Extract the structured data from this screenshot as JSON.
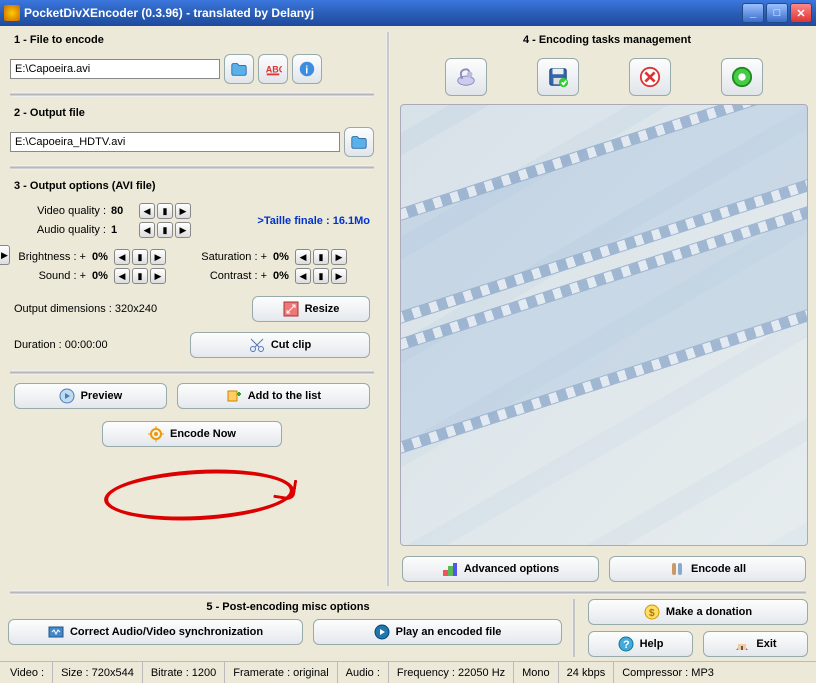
{
  "window": {
    "title": "PocketDivXEncoder (0.3.96) - translated by Delanyj"
  },
  "left": {
    "section1": "1 - File to encode",
    "file_to_encode": "E:\\Capoeira.avi",
    "section2": "2 - Output file",
    "output_file": "E:\\Capoeira_HDTV.avi",
    "section3": "3 - Output options (AVI file)",
    "video_quality_label": "Video quality :",
    "video_quality_value": "80",
    "audio_quality_label": "Audio quality :",
    "audio_quality_value": "1",
    "final_size_label": ">Taille finale : 16.1Mo",
    "brightness_label": "Brightness : +",
    "brightness_value": "0%",
    "sound_label": "Sound : +",
    "sound_value": "0%",
    "saturation_label": "Saturation : +",
    "saturation_value": "0%",
    "contrast_label": "Contrast : +",
    "contrast_value": "0%",
    "output_dims_label": "Output dimensions : 320x240",
    "resize_btn": "Resize",
    "duration_label": "Duration : 00:00:00",
    "cutclip_btn": "Cut clip",
    "preview_btn": "Preview",
    "addlist_btn": "Add to the list",
    "encode_now_btn": "Encode Now"
  },
  "right": {
    "section4": "4 - Encoding tasks management",
    "advanced_btn": "Advanced options",
    "encodeall_btn": "Encode all"
  },
  "bottom": {
    "section5": "5 - Post-encoding misc options",
    "sync_btn": "Correct Audio/Video synchronization",
    "play_btn": "Play an encoded file",
    "donate_btn": "Make a donation",
    "help_btn": "Help",
    "exit_btn": "Exit"
  },
  "status": {
    "video": "Video :",
    "size": "Size : 720x544",
    "bitrate": "Bitrate : 1200",
    "framerate": "Framerate : original",
    "audio": "Audio :",
    "freq": "Frequency : 22050 Hz",
    "mono": "Mono",
    "kbps": "24 kbps",
    "compressor": "Compressor : MP3"
  }
}
